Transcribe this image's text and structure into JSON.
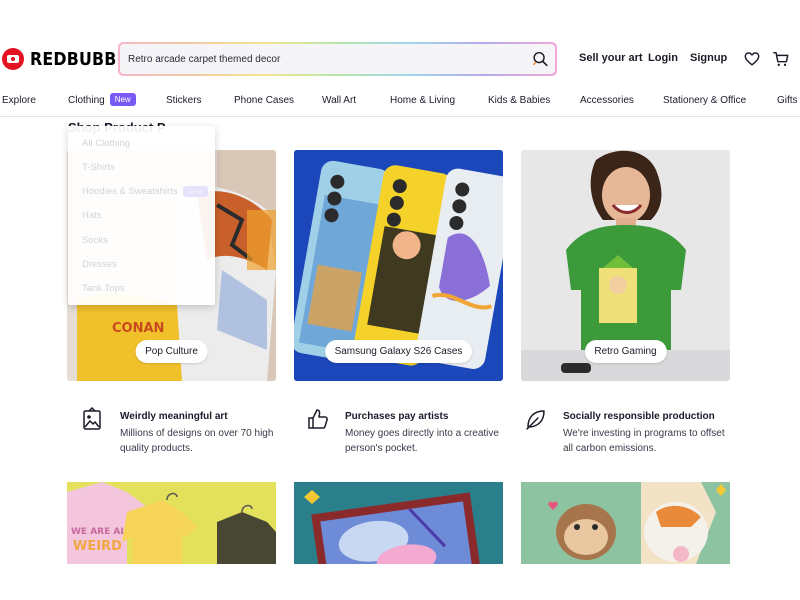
{
  "header": {
    "logo_text": "REDBUBBLE",
    "search_value": "Retro arcade carpet themed decor",
    "links": {
      "sell": "Sell your art",
      "login": "Login",
      "signup": "Signup"
    }
  },
  "nav": {
    "items": [
      "Explore",
      "Clothing",
      "Stickers",
      "Phone Cases",
      "Wall Art",
      "Home & Living",
      "Kids & Babies",
      "Accessories",
      "Stationery & Office",
      "Gifts"
    ],
    "clothing_badge": "New"
  },
  "section_heading": "Shop Product P",
  "dropdown": {
    "items": [
      "All Clothing",
      "T-Shirts",
      "Hoodies & Sweatshirts",
      "Hats",
      "Socks",
      "Dresses",
      "Tank Tops"
    ],
    "hoodies_badge": "New"
  },
  "cards": [
    {
      "label": "Pop Culture"
    },
    {
      "label": "Samsung Galaxy S26 Cases"
    },
    {
      "label": "Retro Gaming"
    }
  ],
  "artwork_text": {
    "pop_shirt": "CONAN",
    "shirts_print_1": "WE ARE ALL",
    "shirts_print_2": "WEIRD"
  },
  "features": [
    {
      "title": "Weirdly meaningful art",
      "text": "Millions of designs on over 70 high quality products.",
      "icon": "artwork-icon"
    },
    {
      "title": "Purchases pay artists",
      "text": "Money goes directly into a creative person's pocket.",
      "icon": "thumbs-up-icon"
    },
    {
      "title": "Socially responsible production",
      "text": "We're investing in programs to offset all carbon emissions.",
      "icon": "leaf-icon"
    }
  ],
  "colors": {
    "brand_red": "#e41321",
    "badge_purple": "#7a5af5",
    "text_dark": "#1b1b29"
  }
}
